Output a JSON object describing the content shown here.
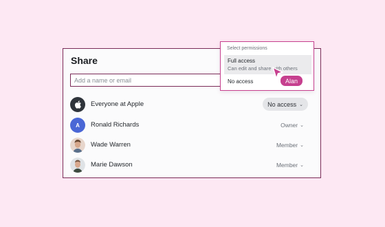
{
  "share": {
    "title": "Share",
    "search_placeholder": "Add a name or email"
  },
  "people": [
    {
      "name": "Everyone at Apple",
      "role": "No access",
      "avatar": "apple-logo-icon"
    },
    {
      "name": "Ronald Richards",
      "role": "Owner",
      "avatar_letter": "A"
    },
    {
      "name": "Wade Warren",
      "role": "Member",
      "avatar": "photo"
    },
    {
      "name": "Marie Dawson",
      "role": "Member",
      "avatar": "photo"
    }
  ],
  "dropdown": {
    "header": "Select permissions",
    "options": [
      {
        "label": "Full access",
        "description": "Can edit and share with others",
        "selected": true
      },
      {
        "label": "No access",
        "selected": false
      }
    ]
  },
  "cursor": {
    "label": "Alan",
    "color": "#c6408f"
  },
  "colors": {
    "accent": "#c6408f",
    "background": "#fde8f3",
    "border": "#7a2a57"
  }
}
